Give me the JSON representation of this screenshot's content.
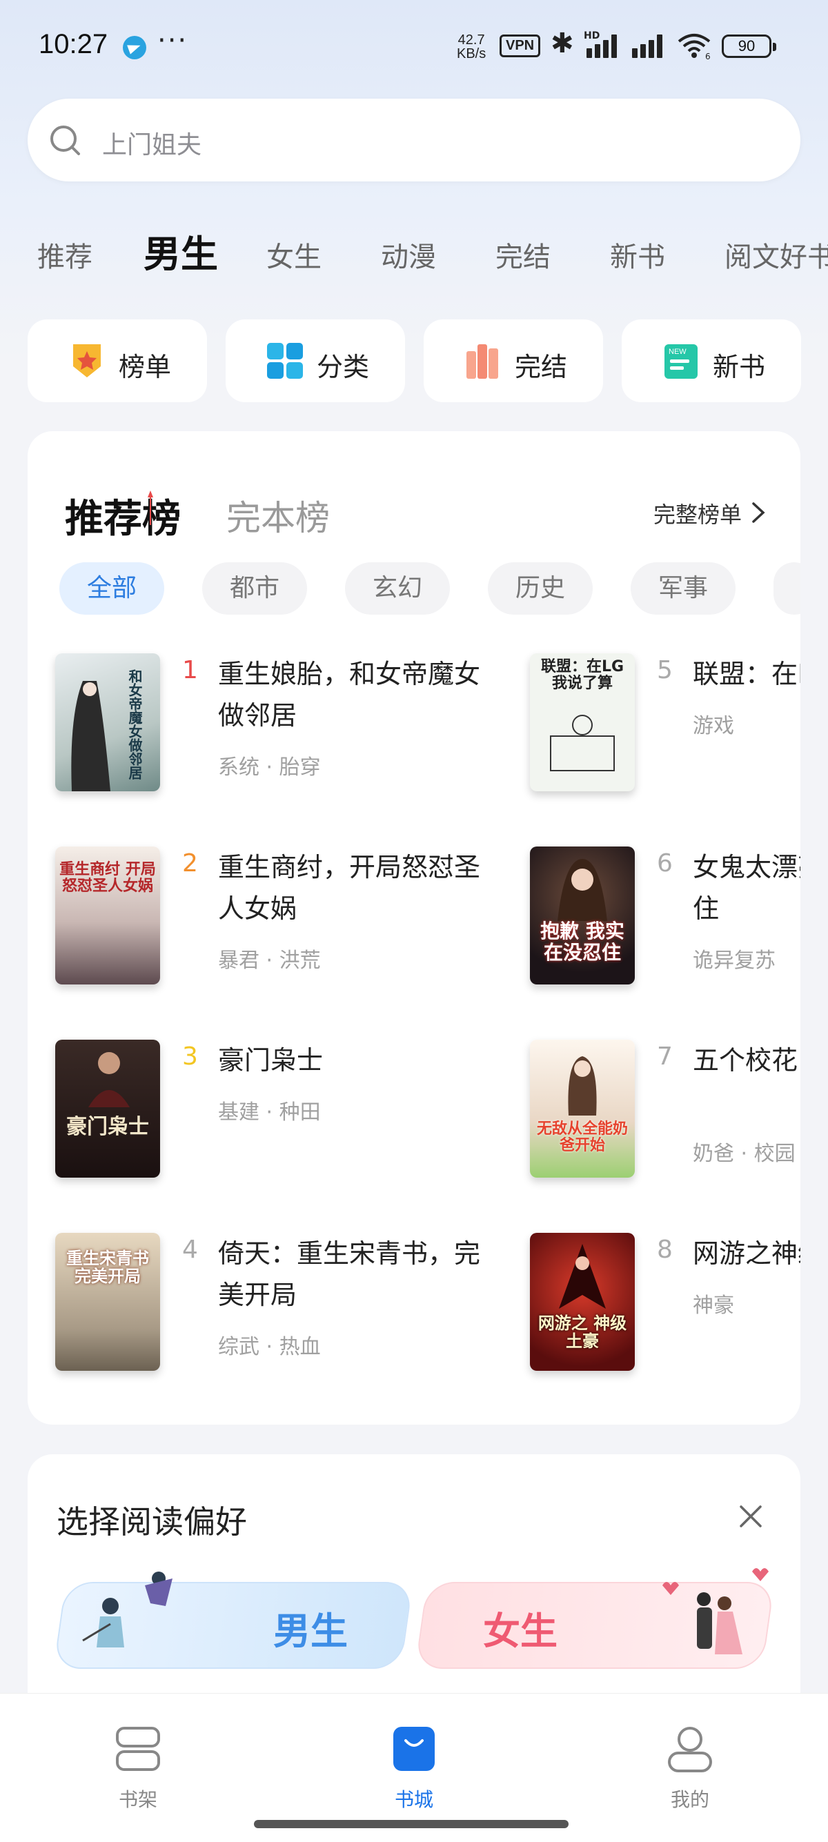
{
  "status_bar": {
    "time": "10:27",
    "dots": "···",
    "net_speed_value": "42.7",
    "net_speed_unit": "KB/s",
    "vpn": "VPN",
    "hd": "HD",
    "wifi_badge": "6",
    "battery": "90"
  },
  "search": {
    "placeholder": "上门姐夫"
  },
  "tabs": [
    "推荐",
    "男生",
    "女生",
    "动漫",
    "完结",
    "新书",
    "阅文好书"
  ],
  "active_tab": "男生",
  "quick_entries": [
    {
      "label": "榜单",
      "icon": "ranking-badge-icon",
      "color": "#f7b731"
    },
    {
      "label": "分类",
      "icon": "category-grid-icon",
      "color": "#2bb5e8"
    },
    {
      "label": "完结",
      "icon": "books-finished-icon",
      "color": "#f48a73"
    },
    {
      "label": "新书",
      "icon": "new-book-icon",
      "color": "#25c7a8"
    }
  ],
  "ranking": {
    "title_active": "推荐榜",
    "title_inactive": "完本榜",
    "full_list": "完整榜单",
    "filters": [
      "全部",
      "都市",
      "玄幻",
      "历史",
      "军事"
    ],
    "active_filter": "全部",
    "books": [
      {
        "rank": "1",
        "title": "重生娘胎，和女帝魔女做邻居",
        "tags": "系统 · 胎穿",
        "cover_text": "和女帝魔女做邻居",
        "rank_color": "#e84a4a"
      },
      {
        "rank": "2",
        "title": "重生商纣，开局怒怼圣人女娲",
        "tags": "暴君 · 洪荒",
        "cover_text": "重生商纣 开局怒怼圣人女娲",
        "rank_color": "#f2902e"
      },
      {
        "rank": "3",
        "title": "豪门枭士",
        "tags": "基建 · 种田",
        "cover_text": "豪门枭士",
        "rank_color": "#f3c623"
      },
      {
        "rank": "4",
        "title": "倚天：重生宋青书，完美开局",
        "tags": "综武 · 热血",
        "cover_text": "重生宋青书 完美开局",
        "rank_color": "#aaaaaa"
      },
      {
        "rank": "5",
        "title": "联盟：在LG我说了算",
        "tags": "游戏",
        "cover_text": "联盟：在LG 我说了算",
        "rank_color": "#aaaaaa"
      },
      {
        "rank": "6",
        "title": "女鬼太漂亮，实在没忍住",
        "tags": "诡异复苏",
        "cover_text": "抱歉 我实在没忍住",
        "rank_color": "#aaaaaa"
      },
      {
        "rank": "7",
        "title": "五个校花，喊我爸！",
        "tags": "奶爸 · 校园",
        "cover_text": "无敌从全能奶爸开始",
        "rank_color": "#aaaaaa"
      },
      {
        "rank": "8",
        "title": "网游之神级土豪",
        "tags": "神豪",
        "cover_text": "网游之 神级土豪",
        "rank_color": "#aaaaaa"
      }
    ]
  },
  "preference": {
    "title": "选择阅读偏好",
    "male": "男生",
    "female": "女生"
  },
  "bottom_nav": [
    {
      "label": "书架",
      "active": false
    },
    {
      "label": "书城",
      "active": true
    },
    {
      "label": "我的",
      "active": false
    }
  ]
}
